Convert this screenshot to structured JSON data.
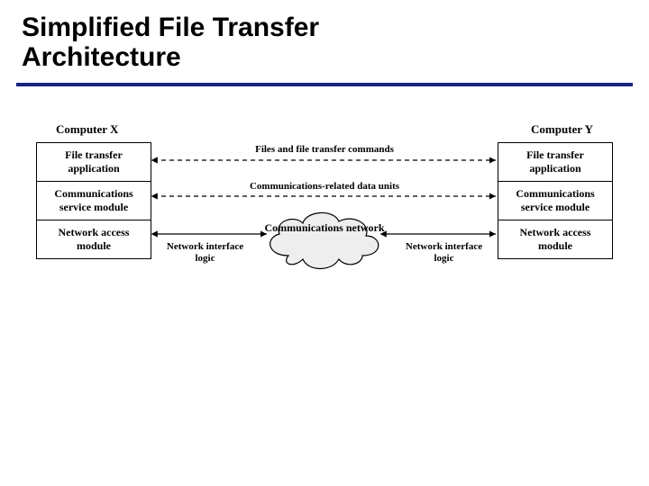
{
  "title_line1": "Simplified File Transfer",
  "title_line2": "Architecture",
  "left": {
    "computer": "Computer X",
    "box1": "File transfer application",
    "box2": "Communications service module",
    "box3": "Network access module"
  },
  "right": {
    "computer": "Computer Y",
    "box1": "File transfer application",
    "box2": "Communications service module",
    "box3": "Network access module"
  },
  "center": {
    "files_label": "Files and file transfer commands",
    "comm_label": "Communications-related data units",
    "niface_label": "Network interface logic",
    "cloud_label": "Communications network"
  }
}
